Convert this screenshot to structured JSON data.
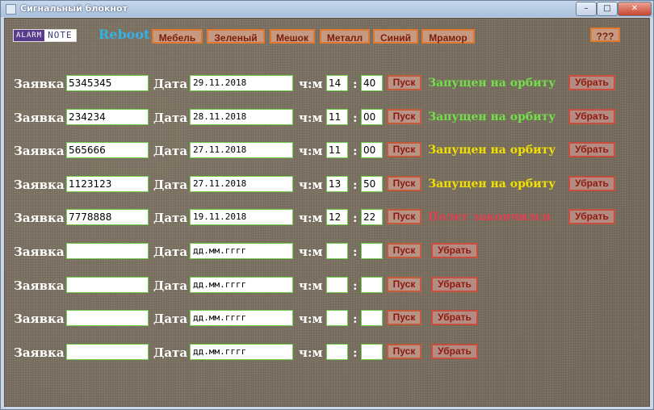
{
  "window": {
    "title": "Сигнальный блокнот",
    "controls": [
      "–",
      "□",
      "✕"
    ]
  },
  "toolbar": {
    "logo_left": "ALARM",
    "logo_right": "NOTE",
    "reboot": "Reboot",
    "themes": [
      "Мебель",
      "Зеленый",
      "Мешок",
      "Металл",
      "Синий",
      "Мрамор"
    ],
    "help": "???"
  },
  "labels": {
    "request": "Заявка",
    "date": "Дата",
    "hm": "ч:м",
    "colon": ":",
    "start": "Пуск",
    "remove": "Убрать"
  },
  "date_placeholder": "дд.мм.гггг",
  "colors": {
    "status_green": "#72e04a",
    "status_yellow": "#f2e000",
    "status_red": "#e04050"
  },
  "rows": [
    {
      "request": "5345345",
      "date": "29.11.2018",
      "hour": "14",
      "minute": "40",
      "status": "Запущен на орбиту",
      "status_color": "#72e04a"
    },
    {
      "request": "234234",
      "date": "28.11.2018",
      "hour": "11",
      "minute": "00",
      "status": "Запущен на орбиту",
      "status_color": "#72e04a"
    },
    {
      "request": "565666",
      "date": "27.11.2018",
      "hour": "11",
      "minute": "00",
      "status": "Запущен на орбиту",
      "status_color": "#f2e000"
    },
    {
      "request": "1123123",
      "date": "27.11.2018",
      "hour": "13",
      "minute": "50",
      "status": "Запущен на орбиту",
      "status_color": "#f2e000"
    },
    {
      "request": "7778888",
      "date": "19.11.2018",
      "hour": "12",
      "minute": "22",
      "status": "Полет закончился",
      "status_color": "#e04050"
    },
    {
      "request": "",
      "date": "",
      "hour": "",
      "minute": "",
      "status": "",
      "status_color": ""
    },
    {
      "request": "",
      "date": "",
      "hour": "",
      "minute": "",
      "status": "",
      "status_color": ""
    },
    {
      "request": "",
      "date": "",
      "hour": "",
      "minute": "",
      "status": "",
      "status_color": ""
    },
    {
      "request": "",
      "date": "",
      "hour": "",
      "minute": "",
      "status": "",
      "status_color": ""
    }
  ]
}
